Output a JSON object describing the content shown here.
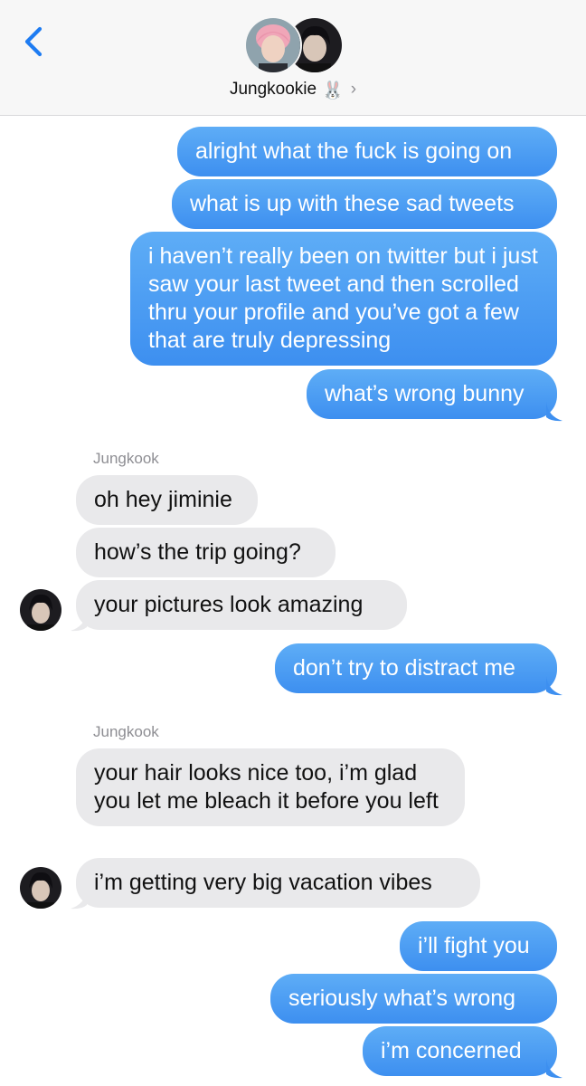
{
  "header": {
    "contact_name": "Jungkookie",
    "contact_emoji": "🐰",
    "chevron": "›",
    "back_icon": "chevron-left-icon",
    "avatar_1": "contact-photo-pink-hair",
    "avatar_2": "contact-photo-dark-hair"
  },
  "colors": {
    "outgoing_bubble": "#3d8ff0",
    "incoming_bubble": "#e9e9eb",
    "accent": "#1e7cf2",
    "header_bg": "#f7f7f7"
  },
  "messages": {
    "m1": "alright what the fuck is going on",
    "m2": "what is up with these sad tweets",
    "m3": "i haven’t really been on twitter but i just saw your last tweet and then scrolled thru your profile and you’ve got a few that are truly depressing",
    "m4": "what’s wrong bunny",
    "sender1": "Jungkook",
    "m5": "oh hey jiminie",
    "m6": "how’s the trip going?",
    "m7": "your pictures look amazing",
    "m8": "don’t try to distract me",
    "sender2": "Jungkook",
    "m9": "your hair looks nice too, i’m glad you let me bleach it before you left",
    "m10": "i’m getting very big vacation vibes",
    "m11": "i’ll fight you",
    "m12": "seriously what’s wrong",
    "m13": "i’m concerned"
  }
}
